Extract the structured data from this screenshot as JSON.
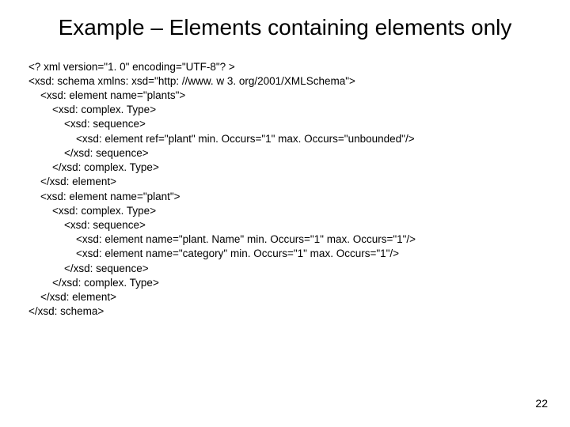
{
  "title": "Example – Elements containing elements only",
  "code_lines": [
    "<? xml version=\"1. 0\" encoding=\"UTF-8\"? >",
    "<xsd: schema xmlns: xsd=\"http: //www. w 3. org/2001/XMLSchema\">",
    "    <xsd: element name=\"plants\">",
    "        <xsd: complex. Type>",
    "            <xsd: sequence>",
    "                <xsd: element ref=\"plant\" min. Occurs=\"1\" max. Occurs=\"unbounded\"/>",
    "            </xsd: sequence>",
    "        </xsd: complex. Type>",
    "    </xsd: element>",
    "    <xsd: element name=\"plant\">",
    "        <xsd: complex. Type>",
    "            <xsd: sequence>",
    "                <xsd: element name=\"plant. Name\" min. Occurs=\"1\" max. Occurs=\"1\"/>",
    "                <xsd: element name=\"category\" min. Occurs=\"1\" max. Occurs=\"1\"/>",
    "            </xsd: sequence>",
    "        </xsd: complex. Type>",
    "    </xsd: element>",
    "</xsd: schema>"
  ],
  "page_number": "22"
}
